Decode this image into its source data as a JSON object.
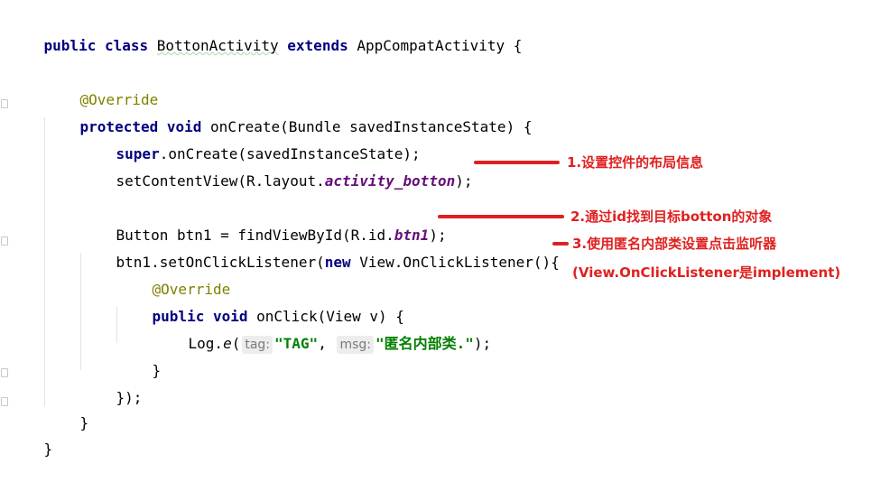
{
  "code": {
    "l1": {
      "public": "public",
      "class": "class",
      "name": "BottonActivity",
      "extends": "extends",
      "super": "AppCompatActivity",
      "brace": "{"
    },
    "l2": {
      "annotation": "@Override"
    },
    "l3": {
      "protected": "protected",
      "void": "void",
      "method": "onCreate(Bundle savedInstanceState)",
      "brace": "{"
    },
    "l4": {
      "super": "super",
      "rest": ".onCreate(savedInstanceState);"
    },
    "l5": {
      "pre": "setContentView(R.layout.",
      "field": "activity_botton",
      "post": ");"
    },
    "l6": {
      "pre": "Button btn1 = findViewById(R.id.",
      "field": "btn1",
      "post": ");"
    },
    "l7": {
      "pre": "btn1.setOnClickListener(",
      "new": "new",
      "post": "View.OnClickListener(){"
    },
    "l8": {
      "annotation": "@Override"
    },
    "l9": {
      "public": "public",
      "void": "void",
      "method": "onClick(View v)",
      "brace": "{"
    },
    "l10": {
      "pre": "Log.",
      "method": "e",
      "open": "(",
      "hint1": "tag:",
      "str1": "\"TAG\"",
      "comma": ",",
      "hint2": "msg:",
      "str2": "\"匿名内部类.\"",
      "close": ");"
    },
    "l11": {
      "text": "}"
    },
    "l12": {
      "text": "});"
    },
    "l13": {
      "text": "}"
    },
    "l14": {
      "text": "}"
    }
  },
  "annotations": [
    {
      "text": "1.设置控件的布局信息"
    },
    {
      "text": "2.通过id找到目标botton的对象"
    },
    {
      "text": "3.使用匿名内部类设置点击监听器"
    },
    {
      "text": "(View.OnClickListener是implement)"
    }
  ],
  "colors": {
    "keyword": "#000080",
    "annotation": "#808000",
    "field": "#660e7a",
    "string": "#008000",
    "callout": "#e02020"
  }
}
